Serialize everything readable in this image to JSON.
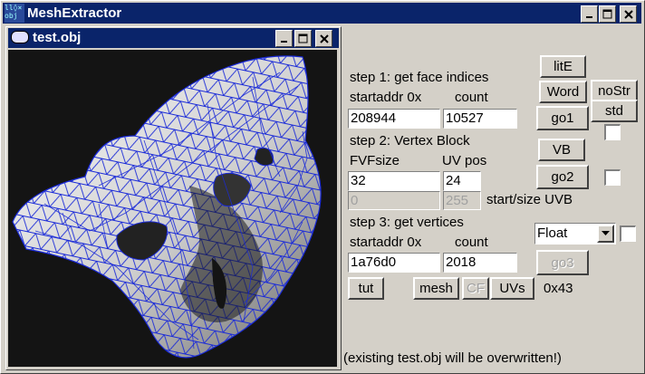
{
  "app": {
    "title": "MeshExtractor",
    "icon_text": "ll◊× obj"
  },
  "child": {
    "title": "test.obj"
  },
  "step1": {
    "label": "step 1: get face indices",
    "addr_label": "startaddr 0x",
    "count_label": "count",
    "addr_value": "208944",
    "count_value": "10527"
  },
  "step2": {
    "label": "step 2: Vertex Block",
    "fvf_label": "FVFsize",
    "uv_label": "UV pos",
    "fvf_value": "32",
    "uv_value": "24",
    "uvb_start": "0",
    "uvb_size": "255",
    "uvb_label": "start/size UVB"
  },
  "step3": {
    "label": "step 3: get vertices",
    "addr_label": "startaddr 0x",
    "count_label": "count",
    "addr_value": "1a76d0",
    "count_value": "2018"
  },
  "buttons": {
    "lite": "litE",
    "word": "Word",
    "nostr": "noStr",
    "std": "std",
    "go1": "go1",
    "vb": "VB",
    "go2": "go2",
    "go3": "go3",
    "tut": "tut",
    "mesh": "mesh",
    "cf": "CF",
    "uvs": "UVs"
  },
  "format_select": {
    "value": "Float"
  },
  "hex_value": "0x43",
  "status": "(existing test.obj will be overwritten!)",
  "colors": {
    "titlebar": "#0a246a",
    "wire": "#1020c8",
    "viewport": "#141414"
  }
}
